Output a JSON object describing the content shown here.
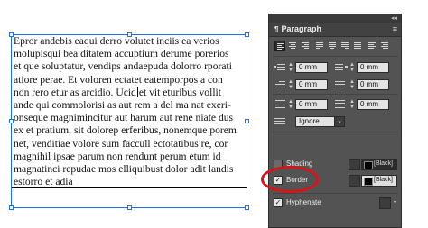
{
  "text_frame": {
    "lines": [
      "Epror andebis eaqui derro volutet inciis ea verios",
      "molupisqui bea ditatem accuptium derume porerios",
      "et que soluptatur, vendips andaepuda dolorro rporati",
      "atiore perae. Et voloren ectatet eatemporpos a con",
      "non rero etur as arcidio. Ucid",
      "et vit eturibus vollit",
      "ande qui commolorisi as aut rem a del ma nat exeri-",
      "onseque magnimincitur aut harum aut rene niate dus",
      "ex et pratium, sit dolorep erferibus, nonemque porem",
      "net, venditiae volore sum faccull ectotatibus re, cor",
      "magnihil ipsae parum non rendunt perum etum id",
      "magnatinci repudae mos elliquibust dolor adit landis",
      "estorro et adia"
    ]
  },
  "panel": {
    "title": "Paragraph",
    "menu_glyph": "≡",
    "collapse_glyph": "◂◂",
    "fields": {
      "left_indent": "0 mm",
      "right_indent": "0 mm",
      "first_line_indent": "0 mm",
      "last_line_indent": "0 mm",
      "space_before": "0 mm",
      "space_after": "0 mm",
      "align_to_grid": "Ignore"
    },
    "shading": {
      "label": "Shading",
      "checked": false,
      "color_label": "[Black]"
    },
    "border": {
      "label": "Border",
      "checked": true,
      "color_label": "[Black]"
    },
    "hyphenate": {
      "label": "Hyphenate",
      "checked": true
    }
  },
  "colors": {
    "highlight_oval": "#d7141a",
    "selection_blue": "#1d6fe0",
    "panel_bg": "#535353"
  }
}
